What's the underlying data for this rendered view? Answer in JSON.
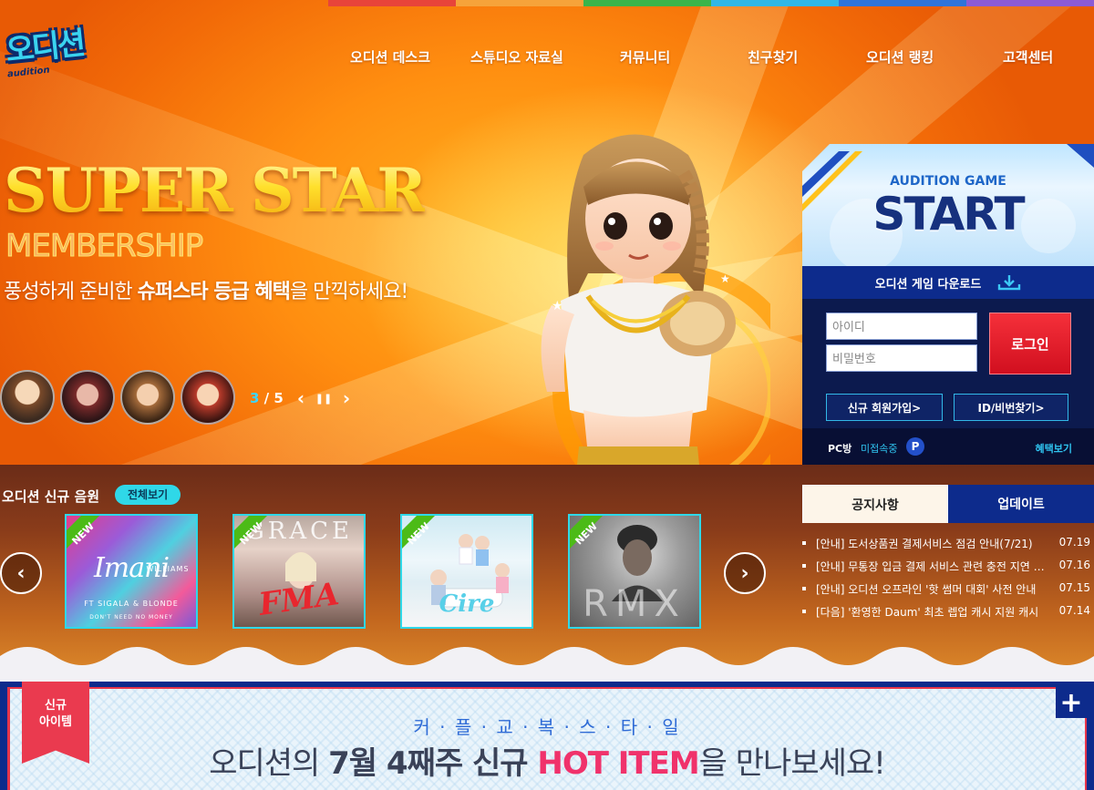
{
  "header": {
    "logo_text": "오디션",
    "logo_sub": "audition",
    "nav": [
      "오디션 데스크",
      "스튜디오 자료실",
      "커뮤니티",
      "친구찾기",
      "오디션 랭킹",
      "고객센터"
    ]
  },
  "rainbow_colors": [
    "#e8443a",
    "#f6a33a",
    "#3ab54a",
    "#30b7e6",
    "#2f74d9",
    "#8b5bd6"
  ],
  "hero": {
    "headline": "SUPER STAR",
    "subline": "MEMBERSHIP",
    "tagline_pre": "풍성하게 준비한 ",
    "tagline_bold": "슈퍼스타 등급 혜택",
    "tagline_post": "을 만끽하세요!",
    "pager_current": "3",
    "pager_total": "/ 5",
    "prev_icon": "‹",
    "pause_icon": "❚❚",
    "next_icon": "›"
  },
  "login": {
    "game_label": "AUDITION GAME",
    "start_label": "START",
    "download_label": "오디션 게임 다운로드",
    "id_placeholder": "아이디",
    "pw_placeholder": "비밀번호",
    "login_button": "로그인",
    "signup_button": "신규 회원가입>",
    "find_button": "ID/비번찾기>",
    "pc_label": "PC방",
    "pc_status": "미접속중",
    "pc_badge": "P",
    "benefit_link": "혜택보기"
  },
  "music": {
    "title": "오디션 신규 음원",
    "view_all": "전체보기",
    "new_tag": "NEW",
    "albums": [
      {
        "line1": "Imani",
        "line2": "WILLIAMS",
        "line3": "FT SIGALA & BLONDE",
        "line4": "DON'T NEED NO MONEY"
      },
      {
        "line1": "GRACE",
        "line2": "FMA"
      },
      {
        "line1": "Cire"
      },
      {
        "line1": "RMX"
      }
    ]
  },
  "notice": {
    "tab_notice": "공지사항",
    "tab_update": "업데이트",
    "items": [
      {
        "text": "[안내] 도서상품권 결제서비스 점검 안내(7/21)",
        "date": "07.19"
      },
      {
        "text": "[안내] 무통장 입금 결제 서비스 관련 충전 지연 안내",
        "date": "07.16"
      },
      {
        "text": "[안내] 오디션 오프라인 '핫 썸머 대회' 사전 안내",
        "date": "07.15"
      },
      {
        "text": "[다음] '환영한 Daum' 최초 렙업 캐시 지원 캐시",
        "date": "07.14"
      }
    ]
  },
  "new_item": {
    "ribbon_line1": "신규",
    "ribbon_line2": "아이템",
    "couple_style": "커 · 플 · 교 · 복 · 스 · 타 · 일",
    "line_pre": "오디션의 ",
    "line_month": "7월 4째주 신규",
    "line_hot": " HOT ITEM",
    "line_post": "을 만나보세요!",
    "plus_icon": "+"
  }
}
